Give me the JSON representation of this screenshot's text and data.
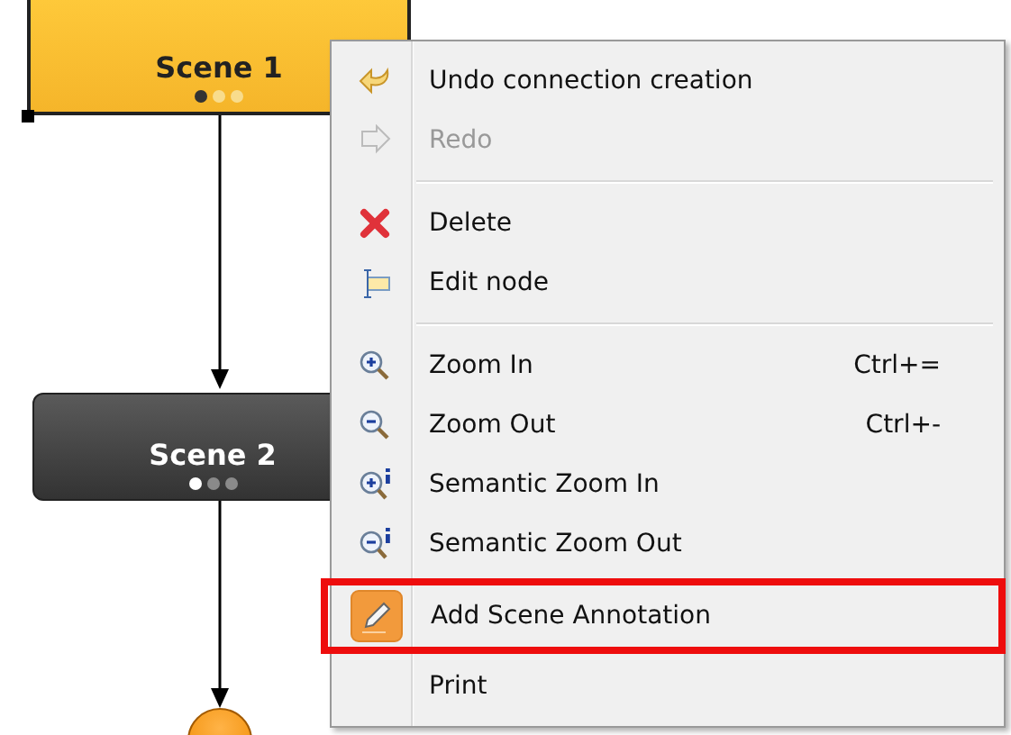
{
  "diagram": {
    "nodes": [
      {
        "kind": "scene",
        "label": "Scene 1",
        "selected": true,
        "dots": [
          {
            "selected": true
          },
          {
            "selected": false
          },
          {
            "selected": false
          }
        ]
      },
      {
        "kind": "scene",
        "label": "Scene 2",
        "selected": false,
        "dots": [
          {
            "selected": true
          },
          {
            "selected": false
          },
          {
            "selected": false
          }
        ]
      },
      {
        "kind": "end"
      }
    ]
  },
  "context_menu": {
    "items": [
      {
        "kind": "command",
        "label": "Undo connection creation",
        "disabled": false
      },
      {
        "kind": "command",
        "label": "Redo",
        "disabled": true
      },
      {
        "kind": "separator"
      },
      {
        "kind": "command",
        "label": "Delete",
        "disabled": false
      },
      {
        "kind": "command",
        "label": "Edit node",
        "disabled": false
      },
      {
        "kind": "separator"
      },
      {
        "kind": "command",
        "label": "Zoom In",
        "shortcut": "Ctrl+=",
        "disabled": false
      },
      {
        "kind": "command",
        "label": "Zoom Out",
        "shortcut": "Ctrl+-",
        "disabled": false
      },
      {
        "kind": "command",
        "label": "Semantic Zoom In",
        "disabled": false
      },
      {
        "kind": "command",
        "label": "Semantic Zoom Out",
        "disabled": false
      },
      {
        "kind": "command",
        "label": "Add Scene Annotation",
        "disabled": false,
        "highlighted": true
      },
      {
        "kind": "command",
        "label": "Print",
        "disabled": false
      }
    ]
  }
}
